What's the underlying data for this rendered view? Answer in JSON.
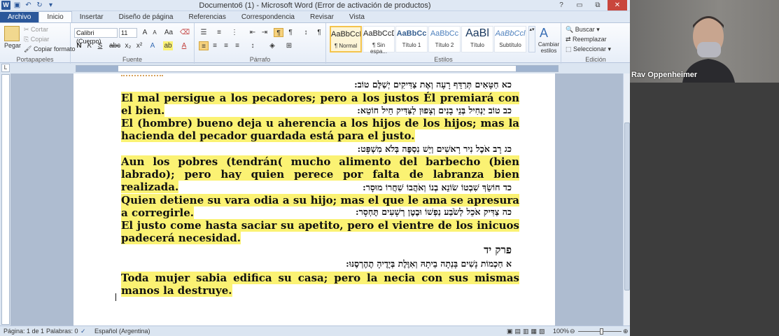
{
  "window": {
    "title": "Documento6 (1)  -  Microsoft Word (Error de activación de productos)",
    "controls": [
      "?",
      "▭",
      "⧉",
      "✕"
    ]
  },
  "tabs": [
    "Archivo",
    "Inicio",
    "Insertar",
    "Diseño de página",
    "Referencias",
    "Correspondencia",
    "Revisar",
    "Vista"
  ],
  "ribbon": {
    "clipboard": {
      "paste": "Pegar",
      "cut": "Cortar",
      "copy": "Copiar",
      "format_painter": "Copiar formato",
      "label": "Portapapeles"
    },
    "font": {
      "name": "Calibri (Cuerpo)",
      "size": "11",
      "label": "Fuente"
    },
    "paragraph": {
      "label": "Párrafo"
    },
    "styles": {
      "label": "Estilos",
      "items": [
        {
          "sample": "AaBbCcDc",
          "name": "¶ Normal"
        },
        {
          "sample": "AaBbCcDc",
          "name": "¶ Sin espa..."
        },
        {
          "sample": "AaBbCc",
          "name": "Título 1"
        },
        {
          "sample": "AaBbCc",
          "name": "Título 2"
        },
        {
          "sample": "AaBl",
          "name": "Título"
        },
        {
          "sample": "AaBbCcl",
          "name": "Subtítulo"
        }
      ],
      "change": "Cambiar estilos"
    },
    "editing": {
      "find": "Buscar",
      "replace": "Reemplazar",
      "select": "Seleccionar",
      "label": "Edición"
    }
  },
  "document": {
    "lines": [
      {
        "kind": "heb",
        "text": "כא חַטָּאִים תְּרַדֵּף רָעָה וְאֶת צַדִּיקִים יְשַׁלֶּם טוֹב:"
      },
      {
        "kind": "es",
        "text": "El mal persigue  a los pecadores; pero a los justos Él premiará  con el bien."
      },
      {
        "kind": "heb",
        "text": "כב טוֹב יַנְחִיל בְּנֵי בָנִים וְצָפוּן לַצַּדִּיק חֵיל חוֹטֵא:"
      },
      {
        "kind": "es",
        "text": "El (hombre) bueno deja u aherencia a los hijos de los hijos; mas la hacienda del pecador guardada está para el justo."
      },
      {
        "kind": "heb",
        "text": "כג רָב אֹכֶל נִיר רָאשִׁים וְיֵשׁ נִסְפֶּה בְּלֹא מִשְׁפָּט:"
      },
      {
        "kind": "es",
        "text": "Aun los pobres (tendrán( mucho alimento del barbecho (bien labrado); pero hay quien perece por falta de labranza bien realizada."
      },
      {
        "kind": "heb",
        "text": "כד חוֹשֵׂךְ שִׁבְטוֹ שׂוֹנֵא בְנוֹ וְאֹהֲבוֹ שִׁחֲרוֹ מוּסָר:"
      },
      {
        "kind": "es",
        "text": "Quien detiene su vara odia a su hijo; mas el que le ama se apresura  a corregirle."
      },
      {
        "kind": "heb",
        "text": "כה צַדִּיק אֹכֵל לְשֹׂבַע נַפְשׁוֹ וּבֶטֶן רְשָׁעִים תֶּחְסָר:"
      },
      {
        "kind": "es",
        "text": "El justo come hasta saciar su apetito, pero el vientre de los inicuos padecerá necesidad."
      },
      {
        "kind": "heb-big",
        "text": "פרק יד"
      },
      {
        "kind": "heb",
        "text": "א חַכְמוֹת נָשִׁים בָּנְתָה בֵיתָהּ וְאִוֶּלֶת בְּיָדֶיהָ תֶהֶרְסֶנּוּ:"
      },
      {
        "kind": "es",
        "text": "Toda mujer sabia edifica su casa; pero la necia con sus mismas manos la destruye."
      }
    ]
  },
  "statusbar": {
    "page": "Página: 1 de 1",
    "words": "Palabras: 0",
    "language": "Español (Argentina)",
    "zoom": "100%"
  },
  "video": {
    "name": "Rav Oppenheimer"
  },
  "colors": {
    "highlight": "#fbf273",
    "word_blue": "#2b579a"
  }
}
